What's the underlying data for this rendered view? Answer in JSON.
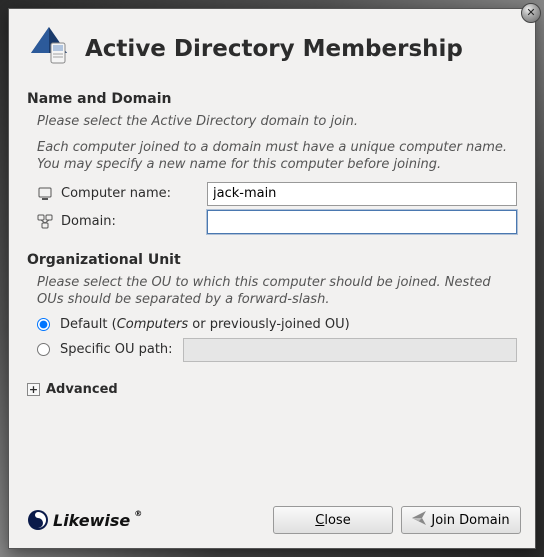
{
  "title": "Active Directory Membership",
  "section1": {
    "heading": "Name and Domain",
    "hint1": "Please select the Active Directory domain to join.",
    "hint2": "Each computer joined to a domain must have a unique computer name.  You may specify a new name for this computer before joining.",
    "computer_label": "Computer name:",
    "computer_value": "jack-main",
    "domain_label": "Domain:",
    "domain_value": ""
  },
  "section2": {
    "heading": "Organizational Unit",
    "hint": "Please select the OU to which this computer should be joined. Nested OUs should be separated by a forward-slash.",
    "radio_default_prefix": "Default (",
    "radio_default_emph": "Computers",
    "radio_default_suffix": " or previously-joined OU)",
    "radio_specific": "Specific OU path:",
    "ou_path_value": ""
  },
  "advanced_label": "Advanced",
  "expander_glyph": "+",
  "logo_text": "Likewise",
  "buttons": {
    "close": "Close",
    "join": "Join Domain"
  }
}
